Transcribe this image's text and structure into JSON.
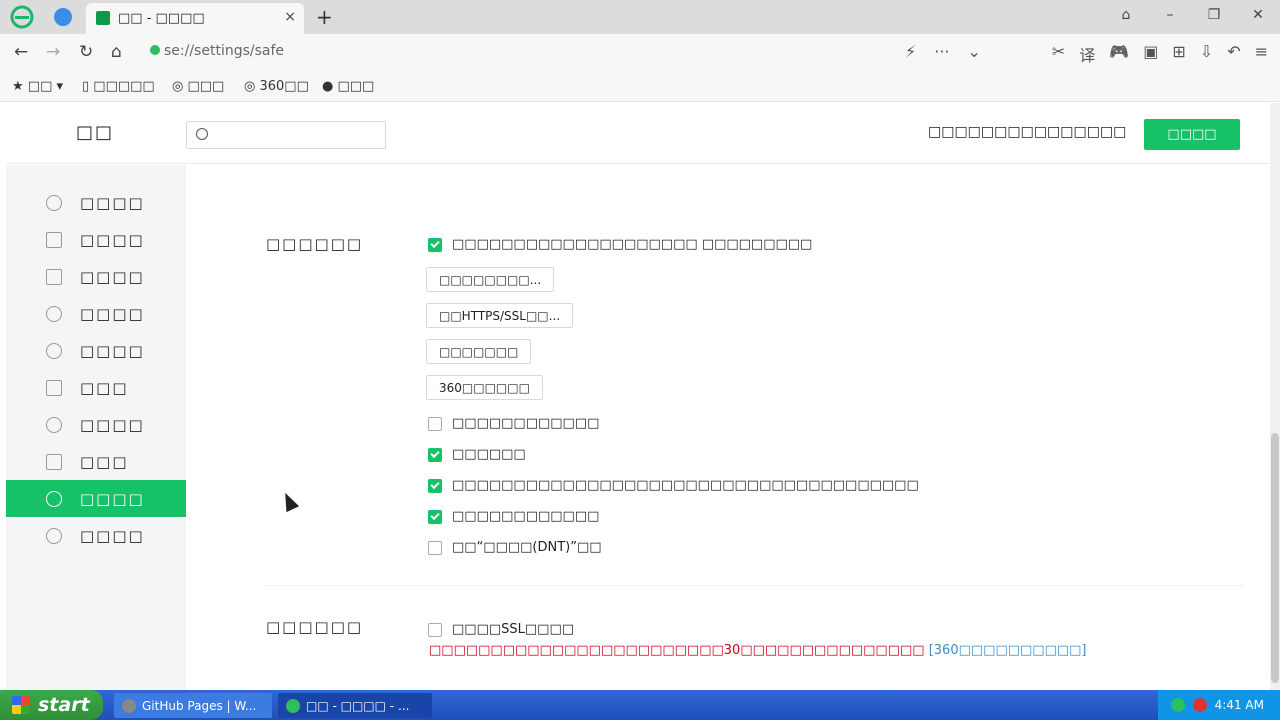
{
  "browser": {
    "tab_title": "□□ - □□□□",
    "tab_close": "×",
    "new_tab": "+",
    "url": "se://settings/safe",
    "win_controls": [
      "⌂",
      "–",
      "❐",
      "✕"
    ],
    "nav": {
      "back": "←",
      "forward": "→",
      "reload": "↻",
      "home": "⌂"
    },
    "addr_mid": [
      "⚡",
      "···",
      "⌄"
    ],
    "addr_tools": [
      "✂",
      "译",
      "🎮",
      "▣",
      "⊞",
      "⇩",
      "↶",
      "≡"
    ],
    "bookmarks": [
      "★ □□  ▾",
      "▯ □□□□□",
      "◎ □□□",
      "◎ 360□□",
      "● □□□"
    ]
  },
  "settings": {
    "title": "□□",
    "search_placeholder": "",
    "tip": "□□□□□□□□□□□□□□□",
    "top_button": "□□□□",
    "sidebar": [
      {
        "label": "□□□□",
        "icon": "gear-icon"
      },
      {
        "label": "□□□□",
        "icon": "window-icon"
      },
      {
        "label": "□□□□",
        "icon": "laptop-icon"
      },
      {
        "label": "□□□□",
        "icon": "lightning-icon"
      },
      {
        "label": "□□□□",
        "icon": "mouse-icon"
      },
      {
        "label": "□□□",
        "icon": "image-icon"
      },
      {
        "label": "□□□□",
        "icon": "tool-icon"
      },
      {
        "label": "□□□",
        "icon": "flask-icon"
      },
      {
        "label": "□□□□",
        "icon": "shield-icon",
        "active": true
      },
      {
        "label": "□□□□",
        "icon": "block-icon"
      }
    ],
    "section1": {
      "title": "□□□□□□",
      "main_option": "□□□□□□□□□□□□□□□□□□□□ □□□□□□□□□",
      "buttons": [
        "□□□□□□□□...",
        "□□HTTPS/SSL□□...",
        "□□□□□□□",
        "360□□□□□□"
      ],
      "options": [
        {
          "label": "□□□□□□□□□□□□",
          "checked": false
        },
        {
          "label": "□□□□□□",
          "checked": true
        },
        {
          "label": "□□□□□□□□□□□□□□□□□□□□□□□□□□□□□□□□□□□□□□",
          "checked": true
        },
        {
          "label": "□□□□□□□□□□□□",
          "checked": true
        },
        {
          "label": "□□“□□□□(DNT)”□□",
          "checked": false
        }
      ]
    },
    "section2": {
      "title": "□□□□□□",
      "option": "□□□□SSL□□□□",
      "checked": false,
      "warning": "□□□□□□□□□□□□□□□□□□□□□□□□30□□□□□□□□□□□□□□□",
      "warning_link": "[360□□□□□□□□□□]"
    }
  },
  "taskbar": {
    "start": "start",
    "items": [
      "GitHub Pages | W...",
      "□□ - □□□□ - ..."
    ],
    "time": "4:41 AM"
  },
  "colors": {
    "accent": "#17c168",
    "warning": "#d00018",
    "link": "#3a8ec9"
  }
}
